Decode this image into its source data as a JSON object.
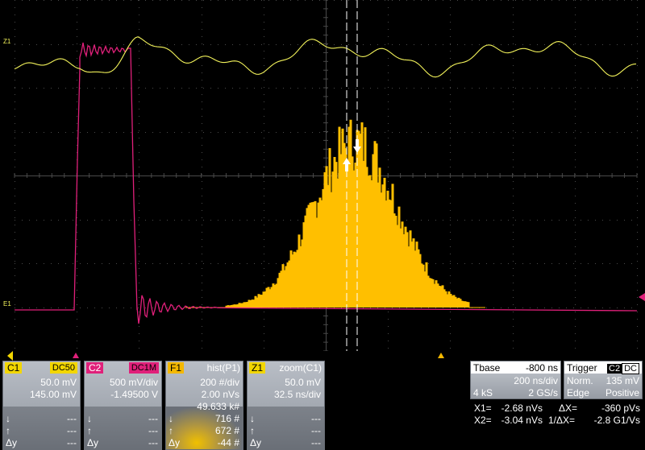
{
  "trace_markers": {
    "z1": "Z1",
    "e1": "E1"
  },
  "colors": {
    "background": "#000000",
    "grid": "#555555",
    "c1_trace": "#f2f25a",
    "c2_trace": "#e0207a",
    "histogram": "#ffbf00",
    "panel": "#9aa0a8"
  },
  "icons": {
    "c2_ground_marker": "triangle-up",
    "trigger_marker": "triangle-up",
    "cursor_1": "arrow-up",
    "cursor_2": "arrow-down",
    "offscreen_right": "triangle-left"
  },
  "panels": {
    "c1": {
      "tag": "C1",
      "coupling": "DC50",
      "scale": "50.0 mV",
      "offset": "145.00 mV",
      "sym1": "↓",
      "sym2": "↑",
      "sym3": "Δy",
      "dash1": "---",
      "dash2": "---",
      "dash3": "---"
    },
    "c2": {
      "tag": "C2",
      "coupling": "DC1M",
      "scale": "500 mV/div",
      "offset": "-1.49500 V",
      "sym1": "↓",
      "sym2": "↑",
      "sym3": "Δy",
      "dash1": "---",
      "dash2": "---",
      "dash3": "---"
    },
    "f1": {
      "tag": "F1",
      "title": "hist(P1)",
      "r1": "200 #/div",
      "r2": "2.00 nVs",
      "r3": "49.633 k#",
      "sym1": "↓",
      "sym2": "↑",
      "sym3": "Δy",
      "v1": "716 #",
      "v2": "672 #",
      "v3": "-44 #"
    },
    "z1": {
      "tag": "Z1",
      "title": "zoom(C1)",
      "r1": "50.0 mV",
      "r2": "32.5 ns/div",
      "sym1": "↓",
      "sym2": "↑",
      "sym3": "Δy",
      "dash1": "---",
      "dash2": "---",
      "dash3": "---"
    }
  },
  "timebase": {
    "label": "Tbase",
    "delay": "-800 ns",
    "rate": "200 ns/div",
    "samples": "4 kS",
    "sample_rate": "2 GS/s"
  },
  "trigger": {
    "label": "Trigger",
    "src": "C2",
    "cpl": "DC",
    "mode": "Norm.",
    "level": "135 mV",
    "type": "Edge",
    "slope": "Positive"
  },
  "cursors": {
    "x1_label": "X1=",
    "x1": "-2.68 nVs",
    "x2_label": "X2=",
    "x2": "-3.04 nVs",
    "dx_label": "ΔX=",
    "dx": "-360 pVs",
    "inv_dx_label": "1/ΔX=",
    "inv_dx": "-2.8 G1/Vs"
  }
}
